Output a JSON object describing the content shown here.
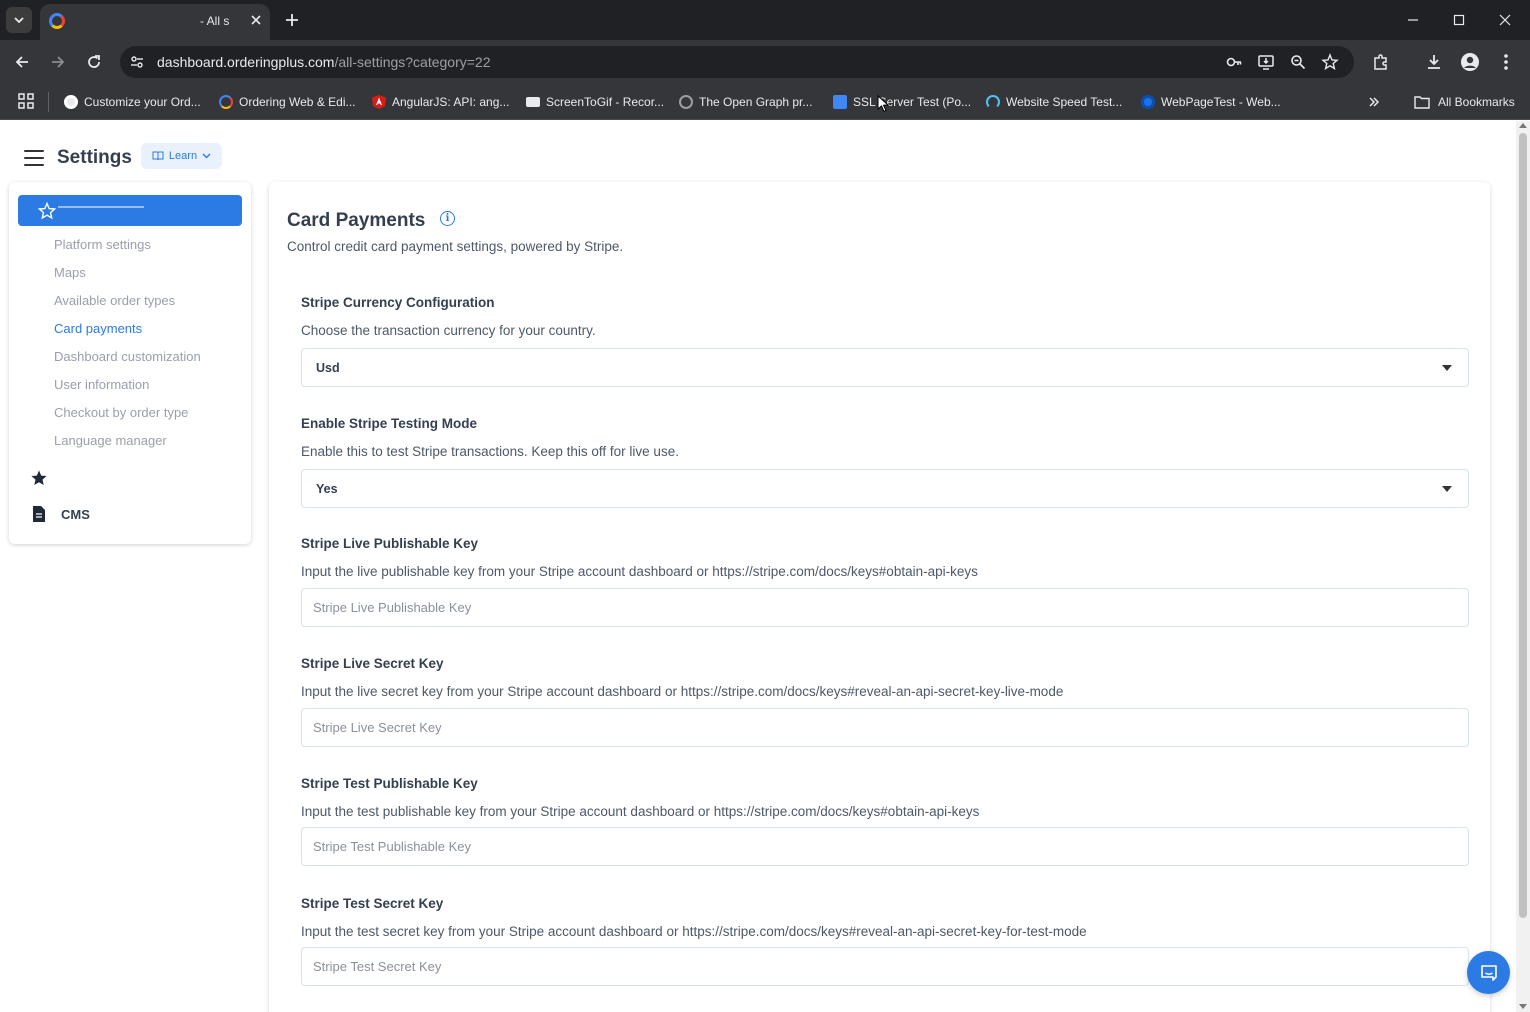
{
  "browser": {
    "tab_title": "- All s",
    "url_domain": "dashboard.orderingplus.com",
    "url_path": "/all-settings?category=22",
    "bookmarks": [
      {
        "label": "Customize your Ord...",
        "icon": "globe-icon"
      },
      {
        "label": "Ordering Web & Edi...",
        "icon": "ordering-icon"
      },
      {
        "label": "AngularJS: API: ang...",
        "icon": "angular-icon"
      },
      {
        "label": "ScreenToGif - Recor...",
        "icon": "screentogif-icon"
      },
      {
        "label": "The Open Graph pr...",
        "icon": "opengraph-icon"
      },
      {
        "label": "SSL Server Test (Po...",
        "icon": "ssl-icon"
      },
      {
        "label": "Website Speed Test...",
        "icon": "speedtest-icon"
      },
      {
        "label": "WebPageTest - Web...",
        "icon": "webpagetest-icon"
      }
    ],
    "all_bookmarks": "All Bookmarks"
  },
  "header": {
    "title": "Settings",
    "learn_label": "Learn"
  },
  "sidebar": {
    "items": [
      {
        "label": "Platform settings"
      },
      {
        "label": "Maps"
      },
      {
        "label": "Available order types"
      },
      {
        "label": "Card payments"
      },
      {
        "label": "Dashboard customization"
      },
      {
        "label": "User information"
      },
      {
        "label": "Checkout by order type"
      },
      {
        "label": "Language manager"
      }
    ],
    "cms_label": "CMS"
  },
  "main": {
    "title": "Card Payments",
    "subtitle": "Control credit card payment settings, powered by Stripe.",
    "fields": [
      {
        "label": "Stripe Currency Configuration",
        "desc": "Choose the transaction currency for your country.",
        "value": "Usd"
      },
      {
        "label": "Enable Stripe Testing Mode",
        "desc": "Enable this to test Stripe transactions. Keep this off for live use.",
        "value": "Yes"
      },
      {
        "label": "Stripe Live Publishable Key",
        "desc": "Input the live publishable key from your Stripe account dashboard or https://stripe.com/docs/keys#obtain-api-keys",
        "placeholder": "Stripe Live Publishable Key",
        "value": ""
      },
      {
        "label": "Stripe Live Secret Key",
        "desc": "Input the live secret key from your Stripe account dashboard or https://stripe.com/docs/keys#reveal-an-api-secret-key-live-mode",
        "placeholder": "Stripe Live Secret Key",
        "value": ""
      },
      {
        "label": "Stripe Test Publishable Key",
        "desc": "Input the test publishable key from your Stripe account dashboard or https://stripe.com/docs/keys#obtain-api-keys",
        "placeholder": "Stripe Test Publishable Key",
        "value": ""
      },
      {
        "label": "Stripe Test Secret Key",
        "desc": "Input the test secret key from your Stripe account dashboard or https://stripe.com/docs/keys#reveal-an-api-secret-key-for-test-mode",
        "placeholder": "Stripe Test Secret Key",
        "value": ""
      }
    ]
  },
  "colors": {
    "accent": "#2c7be5",
    "chrome_dark": "#202124",
    "chrome_mid": "#35363a",
    "text_dark": "#344050",
    "text_muted": "#9a9fab"
  }
}
